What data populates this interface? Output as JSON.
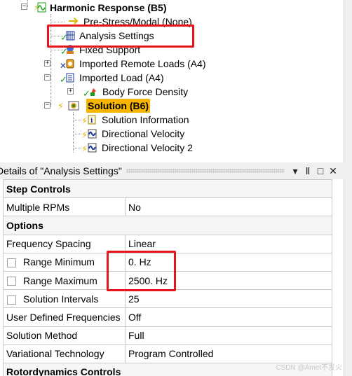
{
  "tree": {
    "root": {
      "label": "Harmonic Response (B5)"
    },
    "items": [
      {
        "label": "Pre-Stress/Modal (None)"
      },
      {
        "label": "Analysis Settings"
      },
      {
        "label": "Fixed Support"
      },
      {
        "label": "Imported Remote Loads (A4)"
      },
      {
        "label": "Imported Load (A4)"
      },
      {
        "label": "Body Force Density"
      },
      {
        "label": "Solution (B6)"
      },
      {
        "label": "Solution Information"
      },
      {
        "label": "Directional Velocity"
      },
      {
        "label": "Directional Velocity 2"
      }
    ]
  },
  "details": {
    "title": "Details of \"Analysis Settings\"",
    "buttons": {
      "dropdown": "▾",
      "pin": "Ⅱ",
      "maximize": "□",
      "close": "✕"
    },
    "rows": [
      {
        "type": "section",
        "name": "Step Controls"
      },
      {
        "type": "prop",
        "name": "Multiple RPMs",
        "value": "No"
      },
      {
        "type": "section",
        "name": "Options"
      },
      {
        "type": "prop",
        "name": "Frequency Spacing",
        "value": "Linear"
      },
      {
        "type": "prop",
        "name": "Range Minimum",
        "value": "0. Hz",
        "checkbox": true
      },
      {
        "type": "prop",
        "name": "Range Maximum",
        "value": "2500. Hz",
        "checkbox": true
      },
      {
        "type": "prop",
        "name": "Solution Intervals",
        "value": "25",
        "checkbox": true
      },
      {
        "type": "prop",
        "name": "User Defined Frequencies",
        "value": "Off"
      },
      {
        "type": "prop",
        "name": "Solution Method",
        "value": "Full"
      },
      {
        "type": "prop",
        "name": "Variational Technology",
        "value": "Program Controlled"
      },
      {
        "type": "section",
        "name": "Rotordynamics Controls"
      }
    ]
  },
  "watermark": "CSDN @Amet不发火",
  "colors": {
    "highlight_box": "#e8141c",
    "solution_highlight": "#f7b500"
  }
}
